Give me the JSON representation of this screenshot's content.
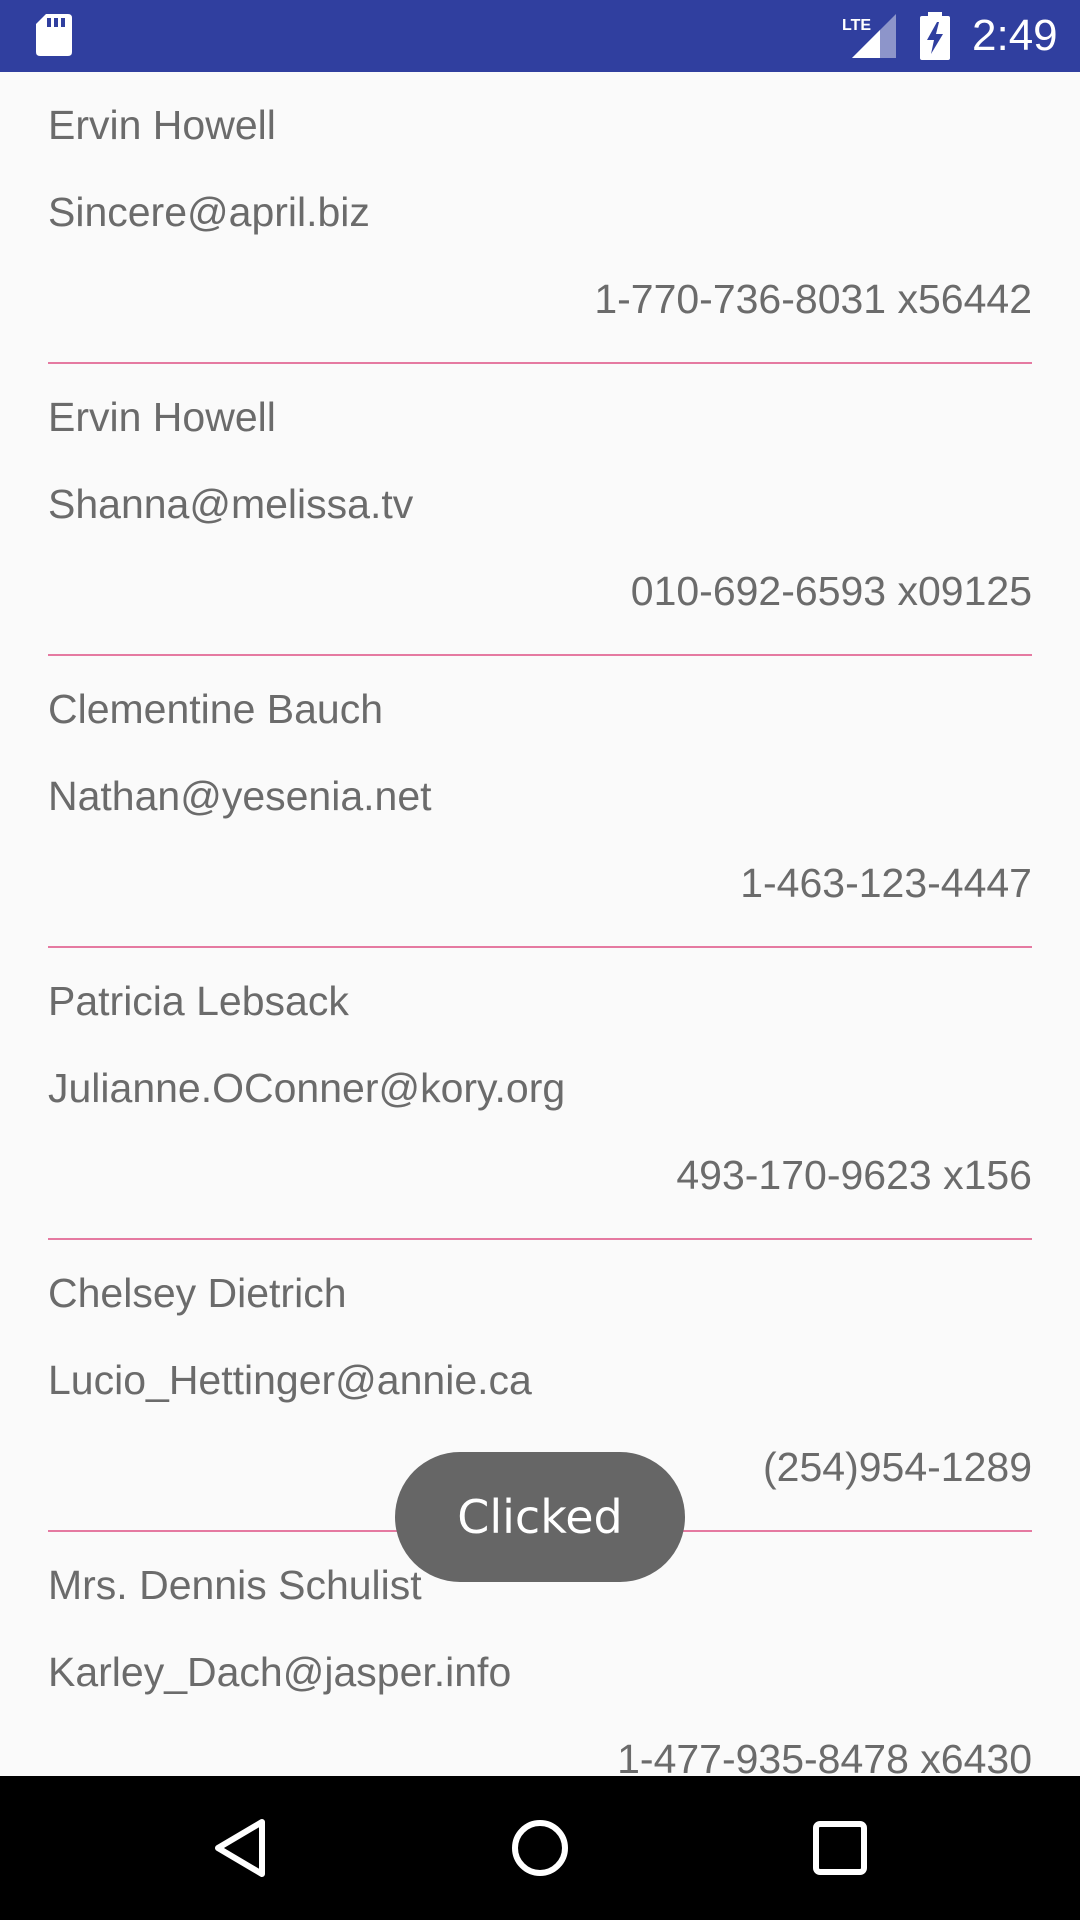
{
  "status_bar": {
    "time": "2:49",
    "network_label": "LTE",
    "icons": [
      "sd-card-icon",
      "lte-signal-icon",
      "battery-charging-icon"
    ]
  },
  "contacts": [
    {
      "name": "Ervin Howell",
      "email": "Sincere@april.biz",
      "phone": "1-770-736-8031 x56442"
    },
    {
      "name": "Ervin Howell",
      "email": "Shanna@melissa.tv",
      "phone": "010-692-6593 x09125"
    },
    {
      "name": "Clementine Bauch",
      "email": "Nathan@yesenia.net",
      "phone": "1-463-123-4447"
    },
    {
      "name": "Patricia Lebsack",
      "email": "Julianne.OConner@kory.org",
      "phone": "493-170-9623 x156"
    },
    {
      "name": "Chelsey Dietrich",
      "email": "Lucio_Hettinger@annie.ca",
      "phone": "(254)954-1289"
    },
    {
      "name": "Mrs. Dennis Schulist",
      "email": "Karley_Dach@jasper.info",
      "phone": "1-477-935-8478 x6430"
    }
  ],
  "toast": {
    "text": "Clicked"
  },
  "nav_bar": {
    "icons": [
      "back-icon",
      "home-icon",
      "recents-icon"
    ]
  },
  "colors": {
    "status_bar": "#303f9f",
    "divider": "#e57aa1",
    "text": "#6b6b6b",
    "toast": "#666666",
    "background": "#fafafa"
  }
}
